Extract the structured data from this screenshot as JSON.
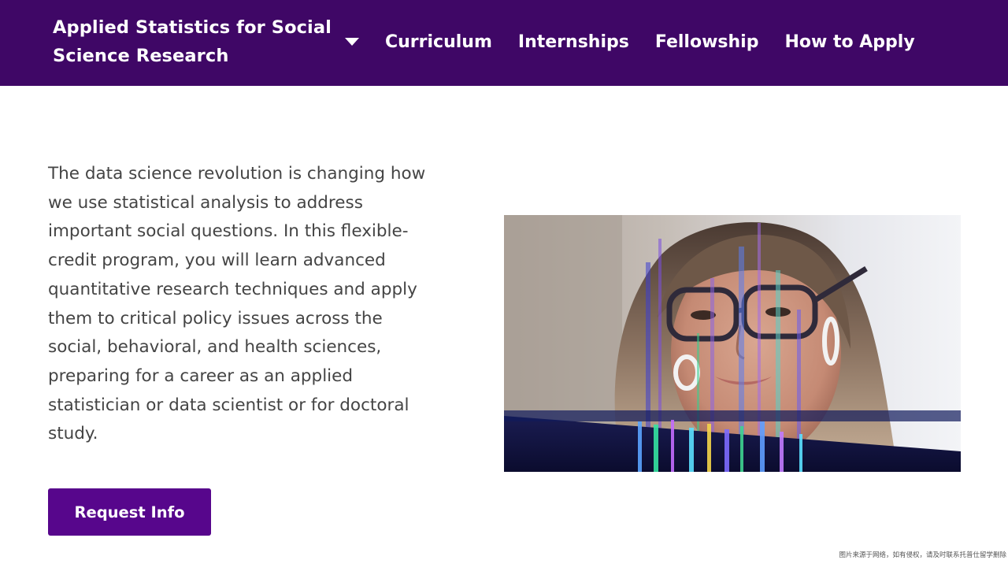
{
  "header": {
    "program_title": "Applied Statistics for Social Science Research",
    "nav": [
      {
        "label": "Curriculum"
      },
      {
        "label": "Internships"
      },
      {
        "label": "Fellowship"
      },
      {
        "label": "How to Apply"
      }
    ],
    "dropdown_icon": "caret-down-icon"
  },
  "main": {
    "intro": "The data science revolution is changing how we use statistical analysis to address important social questions. In this flexible-credit program, you will learn advanced quantitative research techniques and apply them to critical policy issues across the social, behavioral, and health sciences, preparing for a career as an applied statistician or data scientist or for doctoral study.",
    "cta_label": "Request Info"
  },
  "footer": {
    "watermark": "图片来源于网络，如有侵权，请及时联系托普仕留学删除"
  },
  "colors": {
    "header_bg": "#3f0766",
    "button_bg": "#57068c",
    "body_text": "#444444"
  }
}
